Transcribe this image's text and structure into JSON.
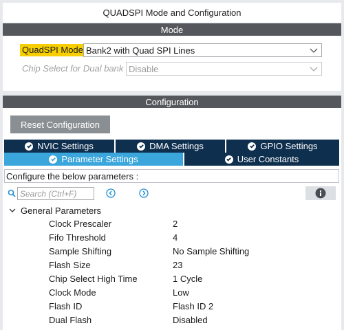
{
  "title": "QUADSPI Mode and Configuration",
  "mode_section": {
    "header": "Mode",
    "fields": [
      {
        "label": "QuadSPI Mode",
        "value": "Bank2 with Quad SPI Lines",
        "enabled": true
      },
      {
        "label": "Chip Select for Dual bank",
        "value": "Disable",
        "enabled": false
      }
    ]
  },
  "config_section": {
    "header": "Configuration",
    "reset_button": "Reset Configuration",
    "tabs_row1": [
      "NVIC Settings",
      "DMA Settings",
      "GPIO Settings"
    ],
    "tabs_row2": [
      "Parameter Settings",
      "User Constants"
    ],
    "active_tab": "Parameter Settings",
    "description": "Configure the below parameters :",
    "search": {
      "placeholder": "Search (Ctrl+F)",
      "value": ""
    },
    "group": {
      "name": "General Parameters",
      "expanded": true,
      "params": [
        {
          "name": "Clock Prescaler",
          "value": "2"
        },
        {
          "name": "Fifo Threshold",
          "value": "4"
        },
        {
          "name": "Sample Shifting",
          "value": "No Sample Shifting"
        },
        {
          "name": "Flash Size",
          "value": "23"
        },
        {
          "name": "Chip Select High Time",
          "value": "1 Cycle"
        },
        {
          "name": "Clock Mode",
          "value": "Low"
        },
        {
          "name": "Flash ID",
          "value": "Flash ID 2"
        },
        {
          "name": "Dual Flash",
          "value": "Disabled"
        }
      ]
    }
  },
  "colors": {
    "section_header": "#54585c",
    "tab_inactive": "#0f2f4f",
    "tab_active": "#3aa6dc",
    "highlight": "#f7cf00",
    "button_gray": "#8a8f94",
    "icon_blue": "#1f8fd6"
  },
  "icons": {
    "search": "search-icon",
    "prev": "arrow-left-circle-icon",
    "next": "arrow-right-circle-icon",
    "info": "info-icon",
    "check": "check-circle-icon",
    "expand": "chevron-down-icon",
    "dropdown": "chevron-down-icon"
  }
}
